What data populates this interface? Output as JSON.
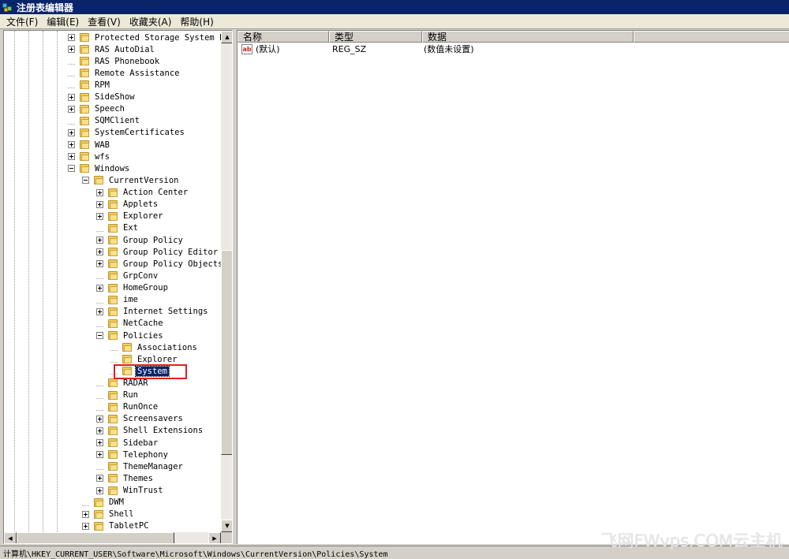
{
  "window": {
    "title": "注册表编辑器",
    "icon": "regedit-icon"
  },
  "menu": [
    "文件(F)",
    "编辑(E)",
    "查看(V)",
    "收藏夹(A)",
    "帮助(H)"
  ],
  "tree": [
    {
      "label": "Protected Storage System Pro",
      "depth": 0,
      "expander": "plus"
    },
    {
      "label": "RAS AutoDial",
      "depth": 0,
      "expander": "plus"
    },
    {
      "label": "RAS Phonebook",
      "depth": 0,
      "expander": "none"
    },
    {
      "label": "Remote Assistance",
      "depth": 0,
      "expander": "none"
    },
    {
      "label": "RPM",
      "depth": 0,
      "expander": "none"
    },
    {
      "label": "SideShow",
      "depth": 0,
      "expander": "plus"
    },
    {
      "label": "Speech",
      "depth": 0,
      "expander": "plus"
    },
    {
      "label": "SQMClient",
      "depth": 0,
      "expander": "none"
    },
    {
      "label": "SystemCertificates",
      "depth": 0,
      "expander": "plus"
    },
    {
      "label": "WAB",
      "depth": 0,
      "expander": "plus"
    },
    {
      "label": "wfs",
      "depth": 0,
      "expander": "plus"
    },
    {
      "label": "Windows",
      "depth": 0,
      "expander": "minus"
    },
    {
      "label": "CurrentVersion",
      "depth": 1,
      "expander": "minus"
    },
    {
      "label": "Action Center",
      "depth": 2,
      "expander": "plus"
    },
    {
      "label": "Applets",
      "depth": 2,
      "expander": "plus"
    },
    {
      "label": "Explorer",
      "depth": 2,
      "expander": "plus"
    },
    {
      "label": "Ext",
      "depth": 2,
      "expander": "none"
    },
    {
      "label": "Group Policy",
      "depth": 2,
      "expander": "plus"
    },
    {
      "label": "Group Policy Editor",
      "depth": 2,
      "expander": "plus"
    },
    {
      "label": "Group Policy Objects",
      "depth": 2,
      "expander": "plus"
    },
    {
      "label": "GrpConv",
      "depth": 2,
      "expander": "none"
    },
    {
      "label": "HomeGroup",
      "depth": 2,
      "expander": "plus"
    },
    {
      "label": "ime",
      "depth": 2,
      "expander": "none"
    },
    {
      "label": "Internet Settings",
      "depth": 2,
      "expander": "plus"
    },
    {
      "label": "NetCache",
      "depth": 2,
      "expander": "none"
    },
    {
      "label": "Policies",
      "depth": 2,
      "expander": "minus"
    },
    {
      "label": "Associations",
      "depth": 3,
      "expander": "none"
    },
    {
      "label": "Explorer",
      "depth": 3,
      "expander": "none"
    },
    {
      "label": "System",
      "depth": 3,
      "expander": "none",
      "selected": true
    },
    {
      "label": "RADAR",
      "depth": 2,
      "expander": "none"
    },
    {
      "label": "Run",
      "depth": 2,
      "expander": "none"
    },
    {
      "label": "RunOnce",
      "depth": 2,
      "expander": "none"
    },
    {
      "label": "Screensavers",
      "depth": 2,
      "expander": "plus"
    },
    {
      "label": "Shell Extensions",
      "depth": 2,
      "expander": "plus"
    },
    {
      "label": "Sidebar",
      "depth": 2,
      "expander": "plus"
    },
    {
      "label": "Telephony",
      "depth": 2,
      "expander": "plus"
    },
    {
      "label": "ThemeManager",
      "depth": 2,
      "expander": "none"
    },
    {
      "label": "Themes",
      "depth": 2,
      "expander": "plus"
    },
    {
      "label": "WinTrust",
      "depth": 2,
      "expander": "plus"
    },
    {
      "label": "DWM",
      "depth": 1,
      "expander": "none"
    },
    {
      "label": "Shell",
      "depth": 1,
      "expander": "plus"
    },
    {
      "label": "TabletPC",
      "depth": 1,
      "expander": "plus"
    }
  ],
  "list": {
    "columns": [
      "名称",
      "类型",
      "数据"
    ],
    "rows": [
      {
        "name": "(默认)",
        "type": "REG_SZ",
        "data": "(数值未设置)",
        "icon": "string-value-icon"
      }
    ]
  },
  "status": "计算机\\HKEY_CURRENT_USER\\Software\\Microsoft\\Windows\\CurrentVersion\\Policies\\System",
  "watermark": "飞网FWvps.COM云主机",
  "colors": {
    "titlebar": "#0a246a",
    "selection": "#0a246a",
    "highlight_box": "#e02020"
  }
}
